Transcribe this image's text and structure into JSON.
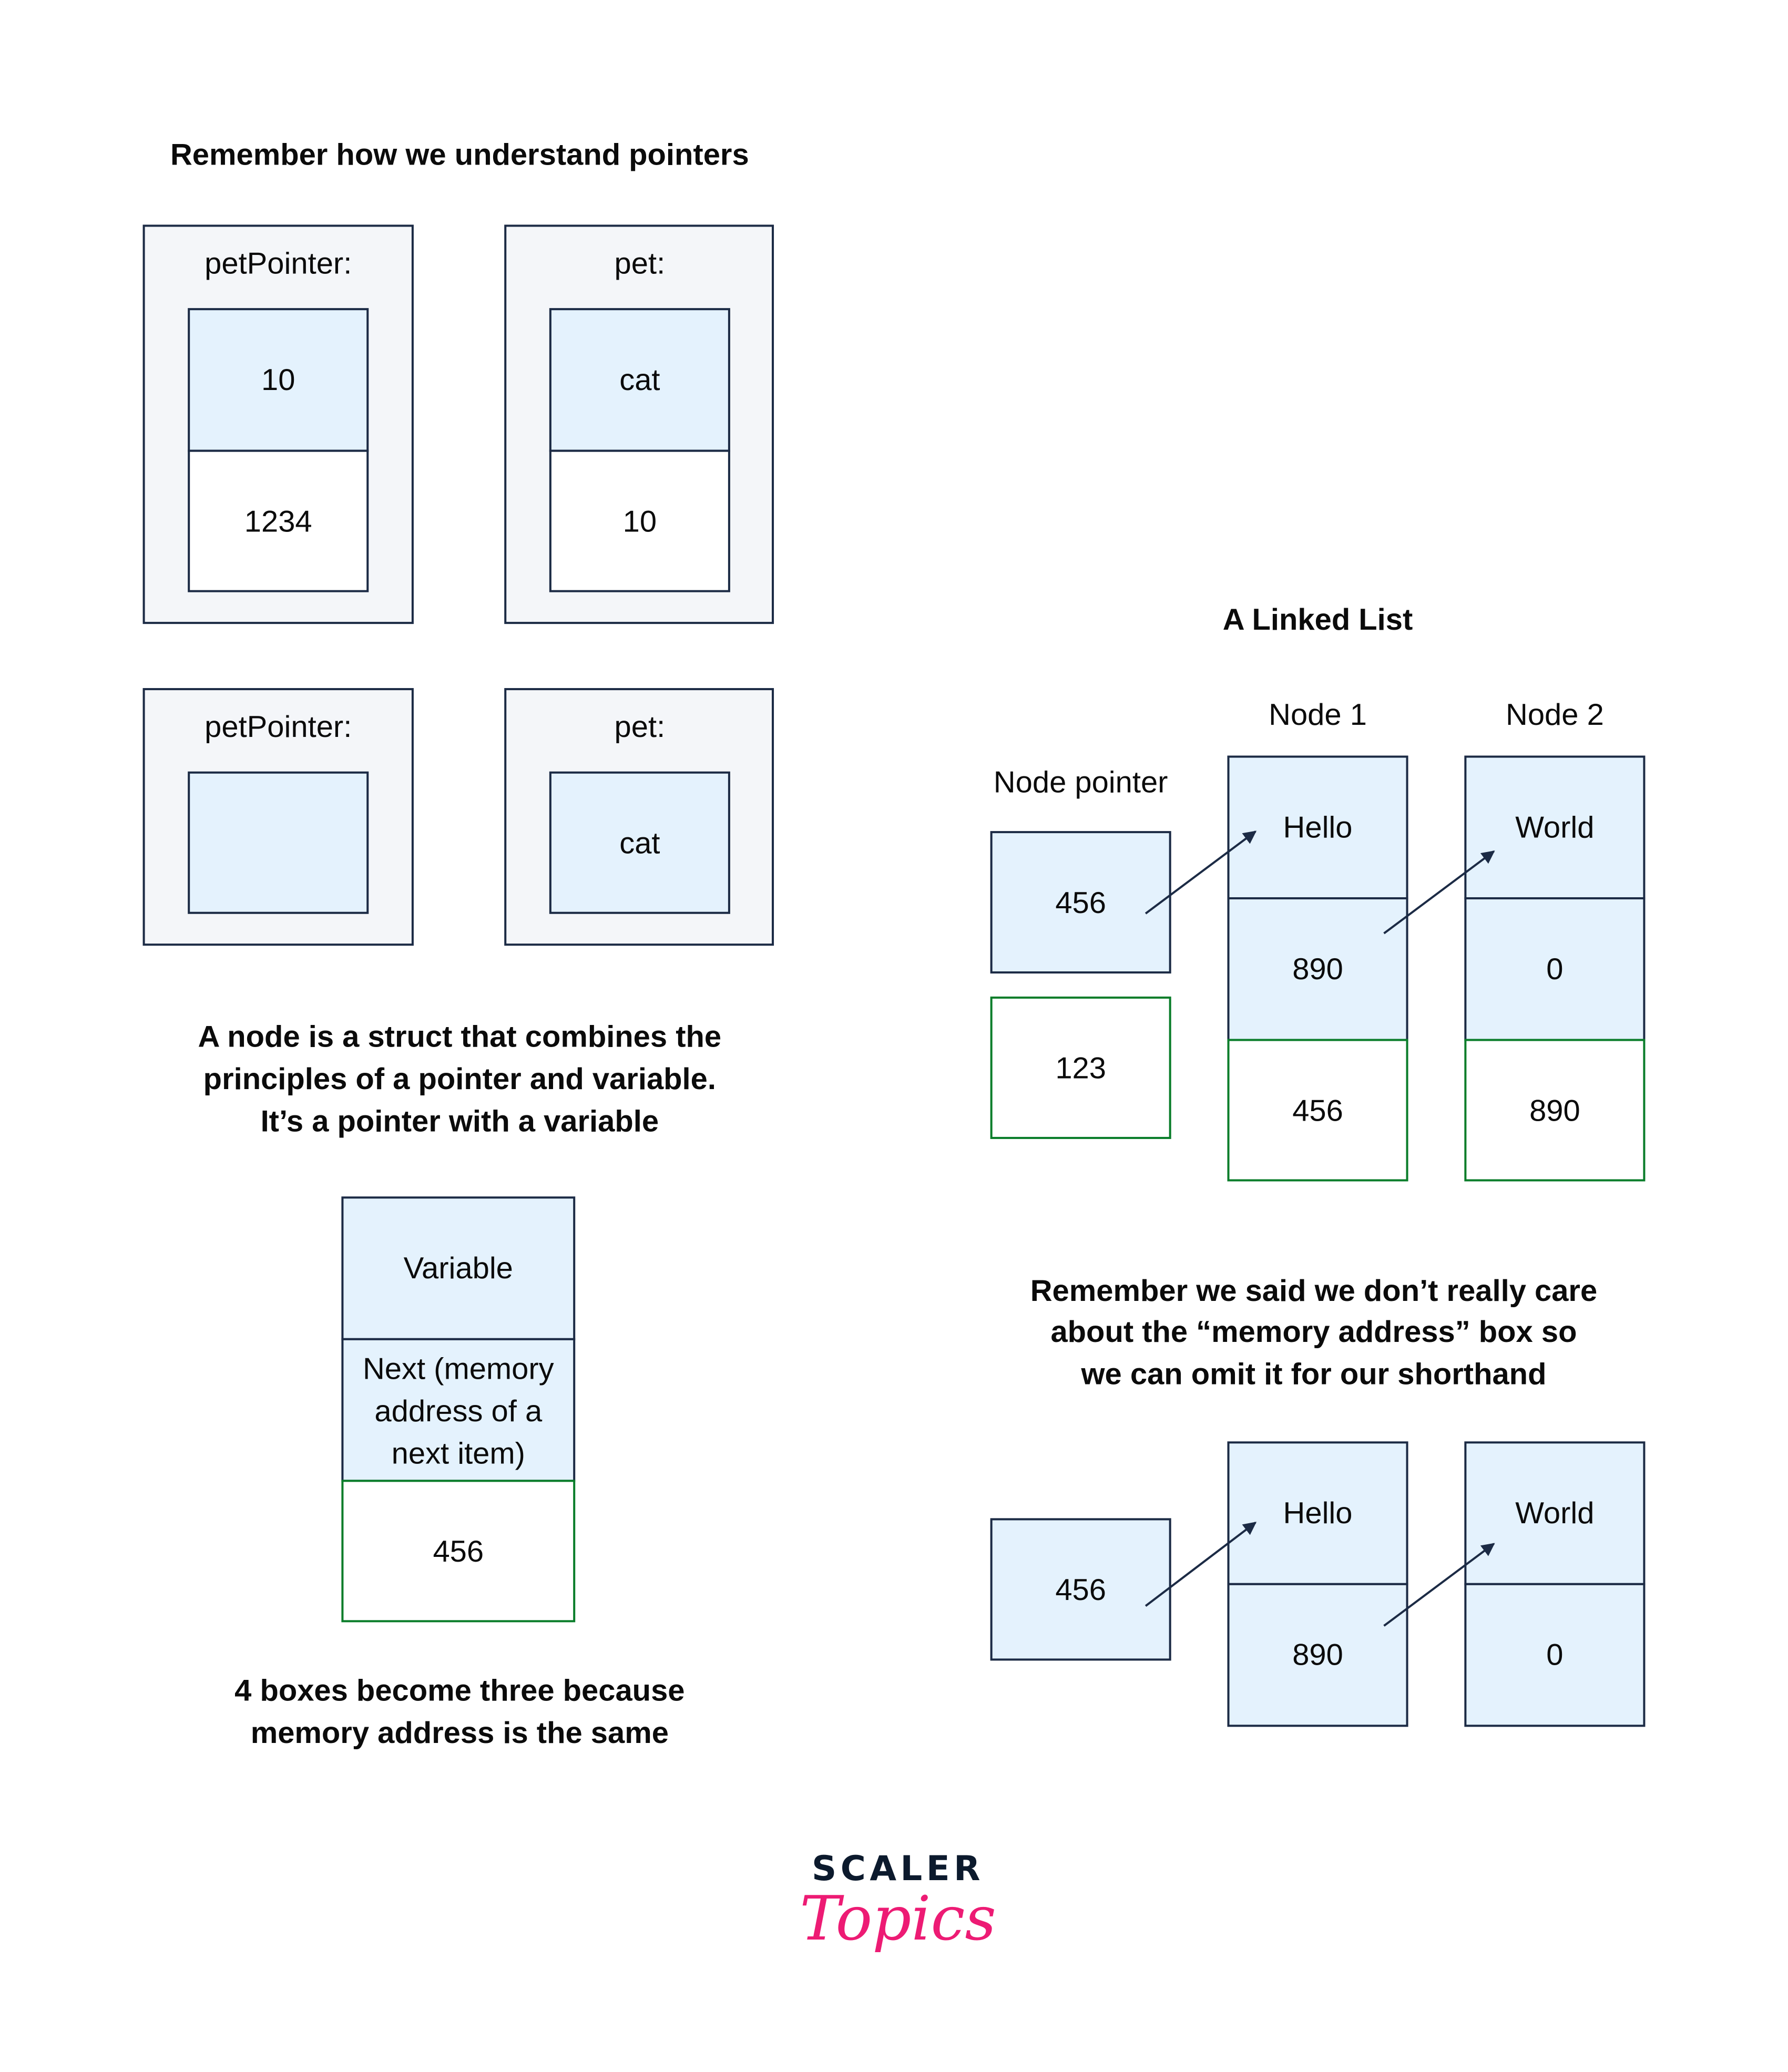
{
  "colors": {
    "outer_fill": "#f4f6f9",
    "box_fill_blue": "#e4f2fd",
    "box_stroke": "#1c2b45",
    "address_stroke_green": "#0a7d2a",
    "logo_dark": "#0c1a2d",
    "logo_pink": "#ed1b74"
  },
  "pointers_section": {
    "title": "Remember how we understand pointers",
    "row1": {
      "petPointer": {
        "label": "petPointer:",
        "value": "10",
        "address": "1234"
      },
      "pet": {
        "label": "pet:",
        "value": "cat",
        "address": "10"
      }
    },
    "row2": {
      "petPointer": {
        "label": "petPointer:",
        "value": ""
      },
      "pet": {
        "label": "pet:",
        "value": "cat"
      }
    }
  },
  "node_section": {
    "description": [
      "A node is a struct that combines the",
      "principles of a pointer and variable.",
      "It’s a pointer with a variable"
    ],
    "node": {
      "variable": "Variable",
      "next_lines": [
        "Next (memory",
        "address of a",
        "next item)"
      ],
      "address": "456"
    },
    "caption": [
      "4 boxes become three because",
      "memory address is the same"
    ]
  },
  "linked_list": {
    "title": "A Linked List",
    "pointer_label": "Node pointer",
    "pointer": {
      "value": "456",
      "address": "123"
    },
    "nodes": [
      {
        "label": "Node 1",
        "value": "Hello",
        "next": "890",
        "address": "456"
      },
      {
        "label": "Node 2",
        "value": "World",
        "next": "0",
        "address": "890"
      }
    ]
  },
  "shorthand": {
    "description": [
      "Remember we said we don’t really care",
      "about the “memory address” box so",
      "we can omit it for our shorthand"
    ],
    "pointer_value": "456",
    "nodes": [
      {
        "value": "Hello",
        "next": "890"
      },
      {
        "value": "World",
        "next": "0"
      }
    ]
  },
  "logo": {
    "line1": "SCALER",
    "line2": "Topics"
  }
}
